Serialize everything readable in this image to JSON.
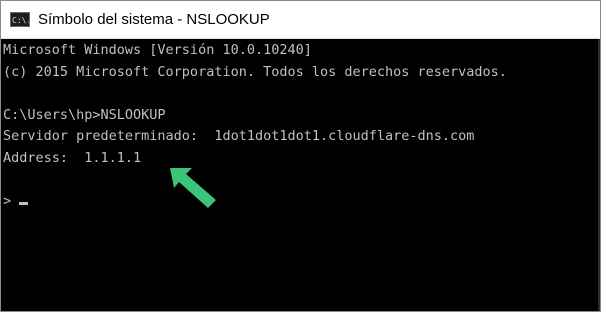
{
  "window": {
    "title": "Símbolo del sistema - NSLOOKUP",
    "icon": "cmd-icon",
    "icon_text": "C:\\."
  },
  "console": {
    "lines": [
      "Microsoft Windows [Versión 10.0.10240]",
      "(c) 2015 Microsoft Corporation. Todos los derechos reservados.",
      "",
      "C:\\Users\\hp>NSLOOKUP",
      "Servidor predeterminado:  1dot1dot1dot1.cloudflare-dns.com",
      "Address:  1.1.1.1",
      "",
      ">"
    ]
  },
  "annotation": {
    "icon": "arrow-icon",
    "color": "#3cc37a"
  },
  "colors": {
    "console_bg": "#000000",
    "console_text": "#c0c0c0",
    "titlebar_bg": "#ffffff"
  }
}
